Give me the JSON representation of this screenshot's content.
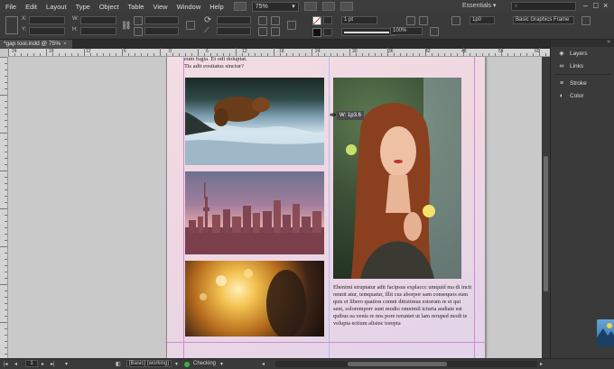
{
  "menubar": {
    "items": [
      "File",
      "Edit",
      "Layout",
      "Type",
      "Object",
      "Table",
      "View",
      "Window",
      "Help"
    ],
    "zoom": "75%",
    "workspace": "Essentials",
    "search_placeholder": ""
  },
  "controlbar": {
    "w_label": "W:",
    "h_label": "H:",
    "stroke_weight": "1 pt",
    "opacity": "100%",
    "gap": "1p0",
    "frame_style": "Basic Graphics Frame"
  },
  "document": {
    "tab_title": "*gap tool.indd @ 75%",
    "tab_close": "×"
  },
  "ruler": {
    "h_labels": [
      "24",
      "18",
      "12",
      "6",
      "0",
      "6",
      "12",
      "18",
      "24",
      "30",
      "36",
      "42",
      "48",
      "54",
      "60"
    ]
  },
  "page": {
    "top_text": "eum fugia. Et odi doluptat.\nTis adit eostiatus sinctur?",
    "body_text": "Ehenimi struptatur adit facipsus explaccc umquid ma di incit omnit atur, temquatur, illit cus aborpor sam consequos eum quis et libero quation comni ditistimus estorum re et qui sent, soloremporr sunt modio omnimil icturia audiate est quibus ea venis re nos pore reruntet ut lam reruped modi te volupta ectium alisinc torepta"
  },
  "gap_tooltip": "W: 1p3.6",
  "statusbar": {
    "page_number": "1",
    "master": "[Basic] (working)",
    "preflight": "Checking",
    "preflight_color": "#3fae3f"
  },
  "panels": {
    "items": [
      {
        "label": "Layers",
        "icon": "layers-icon"
      },
      {
        "label": "Links",
        "icon": "links-icon"
      },
      {
        "label": "Stroke",
        "icon": "stroke-icon"
      },
      {
        "label": "Color",
        "icon": "color-icon"
      }
    ]
  }
}
